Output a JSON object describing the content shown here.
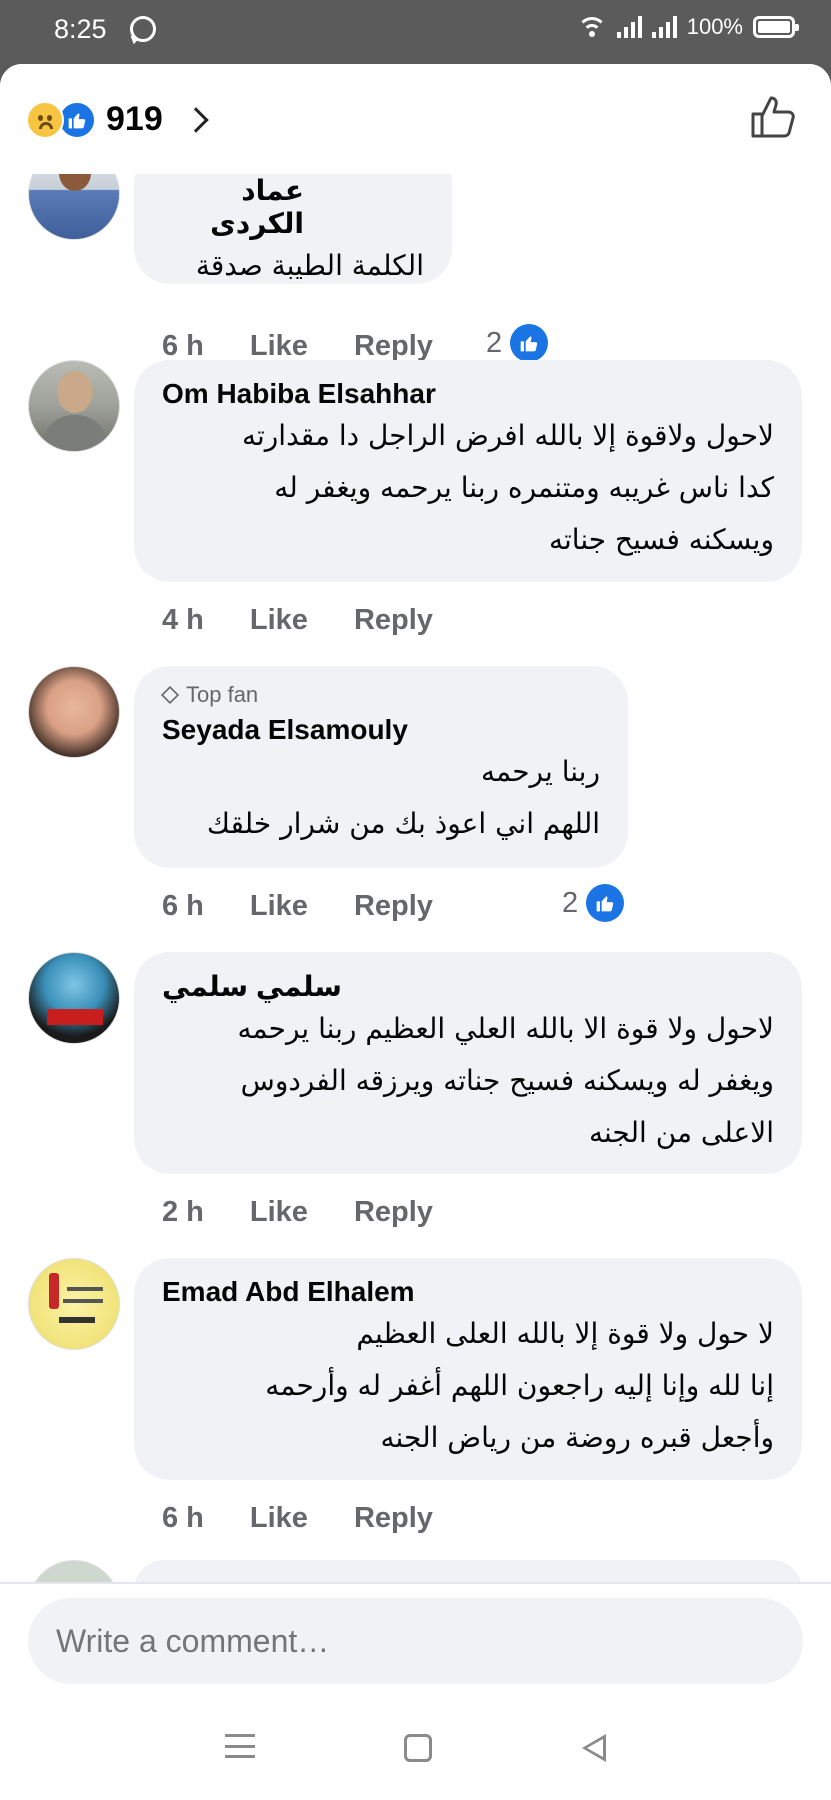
{
  "status_bar": {
    "time": "8:25",
    "battery": "100%"
  },
  "header": {
    "reaction_count": "919",
    "reactions": [
      "sad-reaction",
      "like-reaction"
    ]
  },
  "comments": [
    {
      "name": "عماد الكردى",
      "text": "الكلمة الطيبة صدقة",
      "time": "6 h",
      "like": "Like",
      "reply": "Reply",
      "likes": "2"
    },
    {
      "name": "Om Habiba Elsahhar",
      "text": "لاحول ولاقوة إلا بالله افرض الراجل دا مقدارته\nكدا ناس غريبه ومتنمره ربنا يرحمه ويغفر له\nويسكنه فسيح جناته",
      "time": "4 h",
      "like": "Like",
      "reply": "Reply"
    },
    {
      "badge": "Top fan",
      "name": "Seyada Elsamouly",
      "text": "ربنا يرحمه\nاللهم اني اعوذ بك من شرار خلقك",
      "time": "6 h",
      "like": "Like",
      "reply": "Reply",
      "likes": "2"
    },
    {
      "name": "سلمي سلمي",
      "text": "لاحول ولا قوة الا بالله العلي العظيم ربنا يرحمه\nويغفر له ويسكنه فسيح جناته ويرزقه الفردوس\nالاعلى من الجنه",
      "time": "2 h",
      "like": "Like",
      "reply": "Reply"
    },
    {
      "name": "Emad Abd Elhalem",
      "text": "لا حول ولا قوة إلا بالله العلى العظيم\nإنا لله وإنا إليه راجعون اللهم أغفر له وأرحمه\nوأجعل قبره روضة من رياض الجنه",
      "time": "6 h",
      "like": "Like",
      "reply": "Reply"
    }
  ],
  "composer": {
    "placeholder": "Write a comment…"
  },
  "colors": {
    "accent": "#1b74e4",
    "bubble": "#f0f2f5",
    "meta": "#65676b"
  }
}
